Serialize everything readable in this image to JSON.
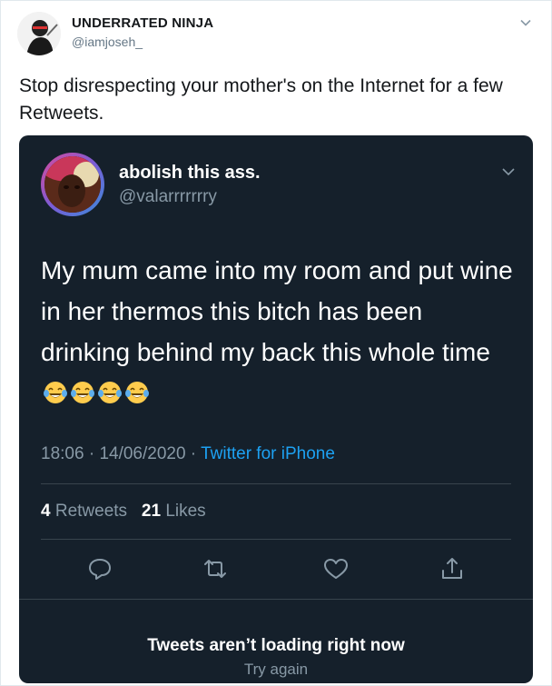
{
  "tweet": {
    "author_name": "UNDERRATED NINJA",
    "author_handle": "@iamjoseh_",
    "text": "Stop disrespecting your mother's on the Internet for a few Retweets."
  },
  "quoted": {
    "author_name": "abolish this ass.",
    "author_handle": "@valarrrrrrry",
    "text": "My mum came into my room and put wine in her thermos this bitch has been drinking behind my back this whole time",
    "emoji": [
      "face-with-tears-of-joy",
      "face-with-tears-of-joy",
      "face-with-tears-of-joy",
      "face-with-tears-of-joy"
    ],
    "time": "18:06",
    "separator": " · ",
    "date": "14/06/2020",
    "source": "Twitter for iPhone",
    "retweets_count": "4",
    "retweets_label": "Retweets",
    "likes_count": "21",
    "likes_label": "Likes"
  },
  "actions": [
    "reply-icon",
    "retweet-icon",
    "like-icon",
    "share-icon"
  ],
  "error": {
    "title": "Tweets aren’t loading right now",
    "retry": "Try again"
  },
  "colors": {
    "dark_bg": "#15202b",
    "accent": "#1da1f2",
    "muted": "#8899a6",
    "divider": "#38444d"
  }
}
